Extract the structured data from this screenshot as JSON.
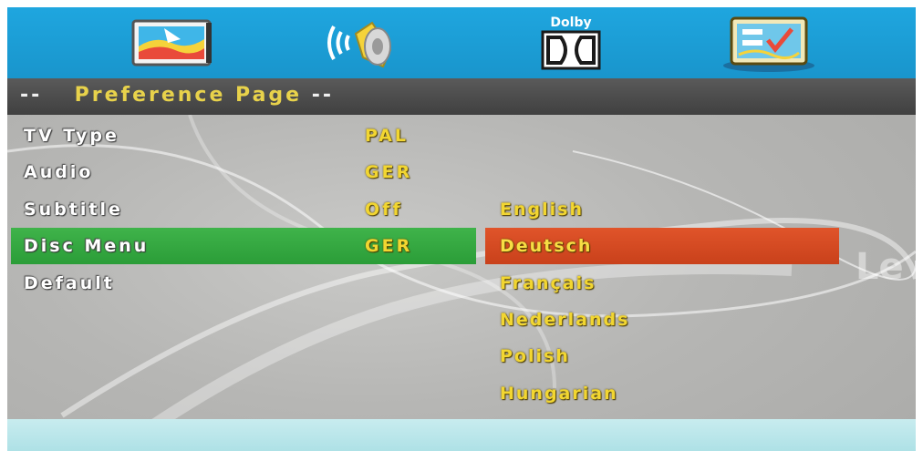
{
  "tabs": [
    {
      "name": "picture-setup",
      "icon": "tv-picture-icon"
    },
    {
      "name": "audio-setup",
      "icon": "speaker-icon"
    },
    {
      "name": "dolby-setup",
      "icon": "dolby-icon",
      "label": "Dolby"
    },
    {
      "name": "preference-setup",
      "icon": "preference-checklist-icon"
    }
  ],
  "header": {
    "dashes_left": "--",
    "title": "Preference Page",
    "dashes_right": "--"
  },
  "menu": [
    {
      "label": "TV Type",
      "value": "PAL"
    },
    {
      "label": "Audio",
      "value": "GER"
    },
    {
      "label": "Subtitle",
      "value": "Off"
    },
    {
      "label": "Disc Menu",
      "value": "GER",
      "selected": true
    },
    {
      "label": "Default",
      "value": ""
    }
  ],
  "options": [
    {
      "label": "English"
    },
    {
      "label": "Deutsch",
      "selected": true
    },
    {
      "label": "Français"
    },
    {
      "label": "Nederlands"
    },
    {
      "label": "Polish"
    },
    {
      "label": "Hungarian"
    }
  ],
  "edge_text": "Le",
  "colors": {
    "topbar": "#1fa6df",
    "header": "#4a4a4a",
    "selected_row": "#3fb34a",
    "selected_option": "#e0542a",
    "value_text": "#f2d631",
    "bottombar": "#bfe8ec"
  }
}
